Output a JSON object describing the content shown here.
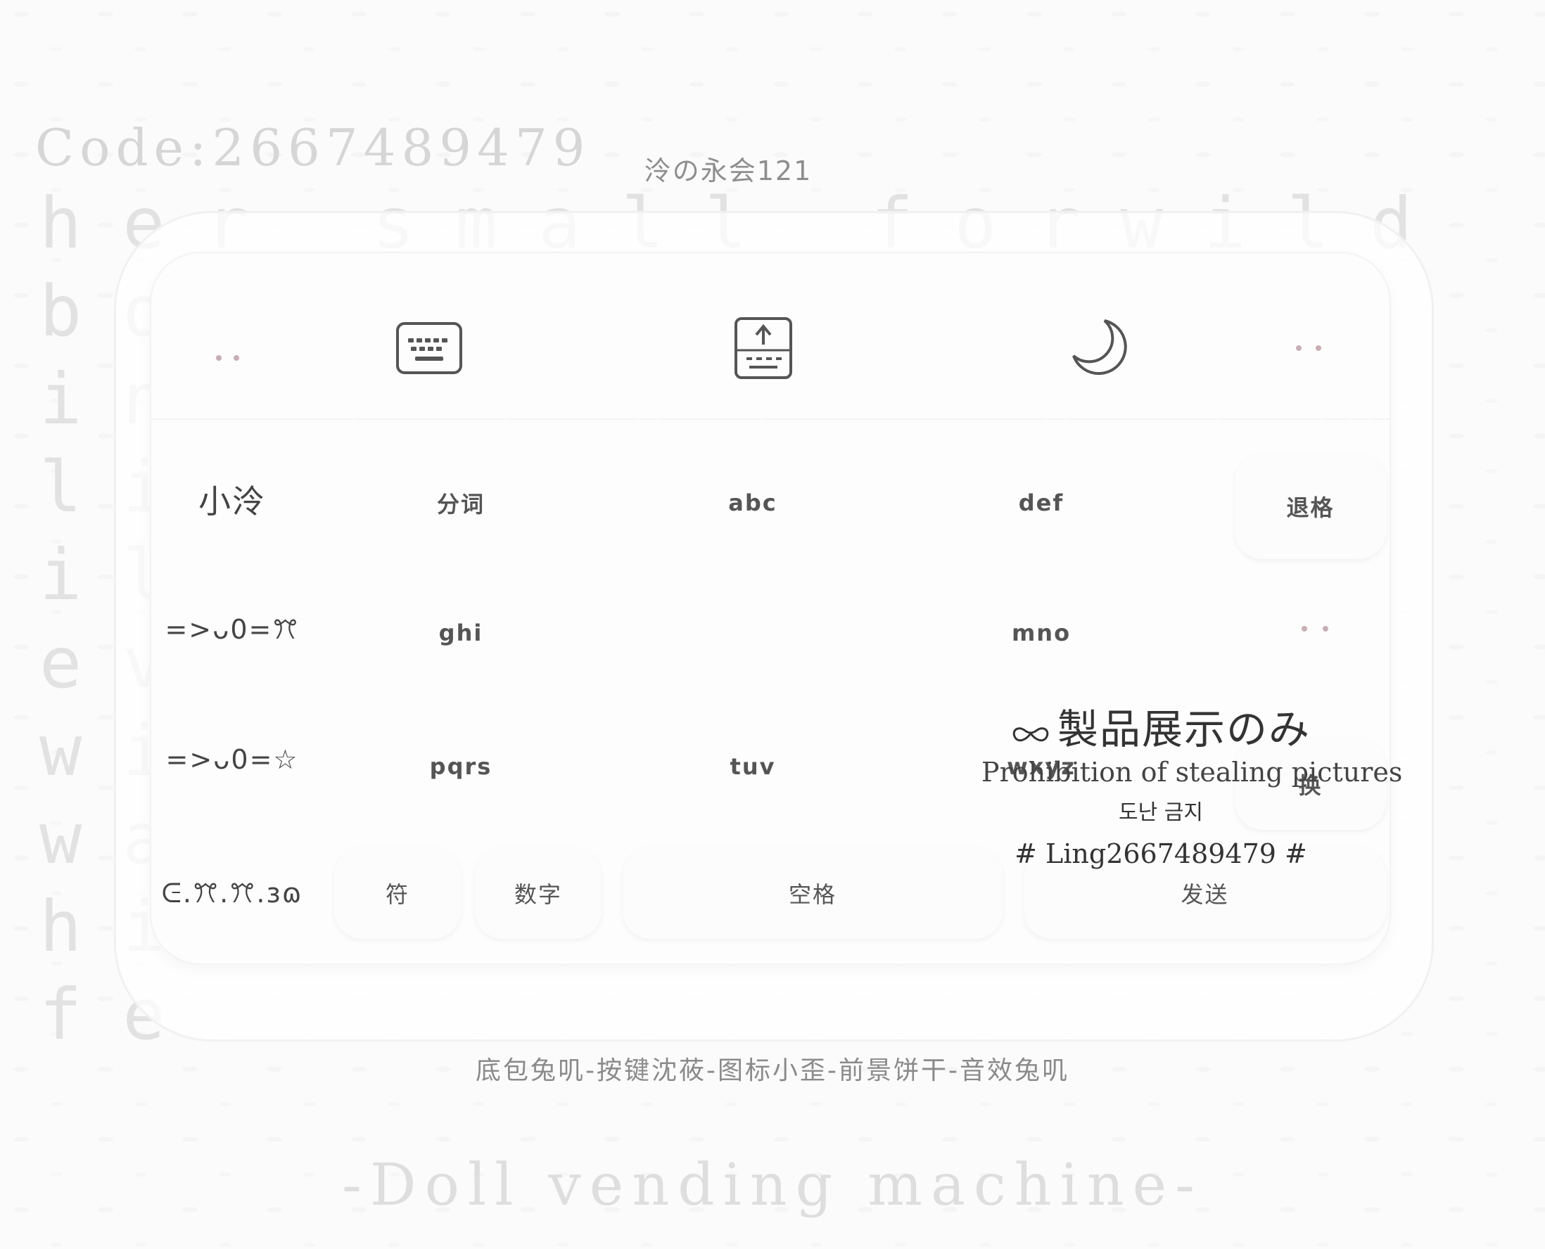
{
  "background": {
    "code_text": "Code:2667489479",
    "poem_lines": [
      "her small forwild",
      "bo",
      "in",
      "li",
      "il",
      "ev",
      "wi",
      "wa",
      "hi",
      "fe"
    ]
  },
  "brand_top": "泠の永会121",
  "credits": "底包兔叽-按键沈莜-图标小歪-前景饼干-音效兔叽",
  "tagline": "-Doll vending machine-",
  "keyboard": {
    "toolbar": {
      "left_icon": "dots-face-icon",
      "keyboard_icon": "keyboard-icon",
      "upload_icon": "keyboard-upload-icon",
      "moon_icon": "moon-icon",
      "right_icon": "dots-face-icon"
    },
    "sidebar": [
      "小泠",
      "=>ᴗ0=ꔫ",
      "=>ᴗ0=☆",
      "ᕮ.ꔫ.ꔫ.ɜɷ"
    ],
    "keys_row1": [
      "分词",
      "abc",
      "def",
      "退格"
    ],
    "keys_row2": [
      "ghi",
      "",
      "mno"
    ],
    "keys_row3": [
      "pqrs",
      "tuv",
      "wxyz",
      "换"
    ],
    "bottom": {
      "fu": "符",
      "shuzi": "数字",
      "kongge": "空格",
      "fasong": "发送"
    }
  },
  "watermark": {
    "title": "製品展示のみ",
    "line1": "Prohibition of stealing pictures",
    "line2": "도난 금지",
    "line3": "# Ling2667489479 #"
  },
  "colors": {
    "dots": "#c9aeb3",
    "text": "#555555"
  }
}
